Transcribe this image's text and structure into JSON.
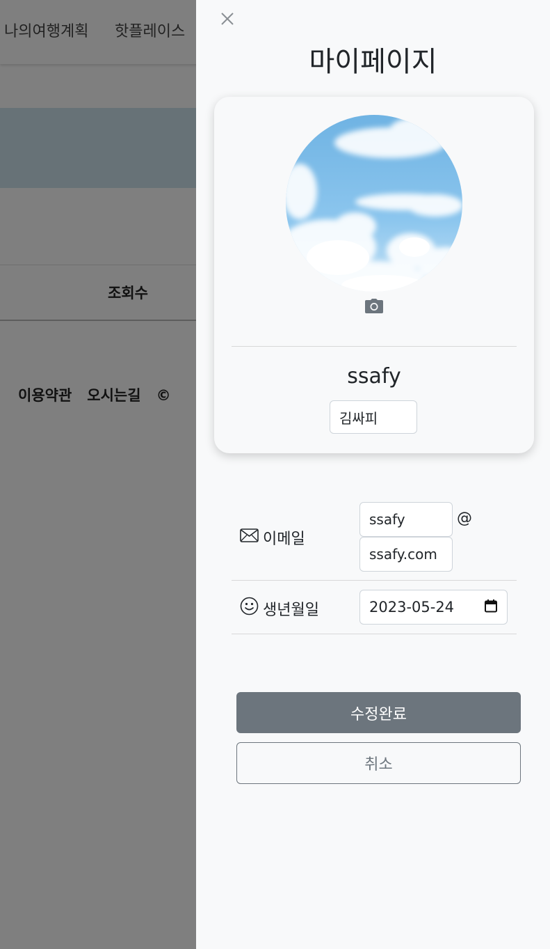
{
  "background": {
    "nav": [
      "나의여행계획",
      "핫플레이스"
    ],
    "table_header": "조회수",
    "footer": [
      "이용약관",
      "오시는길",
      "©"
    ]
  },
  "mypage": {
    "title": "마이페이지",
    "close_icon": "close-icon",
    "camera_icon": "camera-icon",
    "user_id": "ssafy",
    "name": "김싸피",
    "email_label": "이메일",
    "email_icon": "envelope-icon",
    "email_id": "ssafy",
    "email_at": "@",
    "email_domain": "ssafy.com",
    "birth_label": "생년월일",
    "birth_icon": "smiley-icon",
    "birth_date": "2023-05-24",
    "calendar_icon": "calendar-icon",
    "submit_label": "수정완료",
    "cancel_label": "취소"
  },
  "colors": {
    "panel_bg": "#f8f9fa",
    "primary_btn": "#6c757d",
    "backdrop": "rgba(0,0,0,0.5)"
  }
}
